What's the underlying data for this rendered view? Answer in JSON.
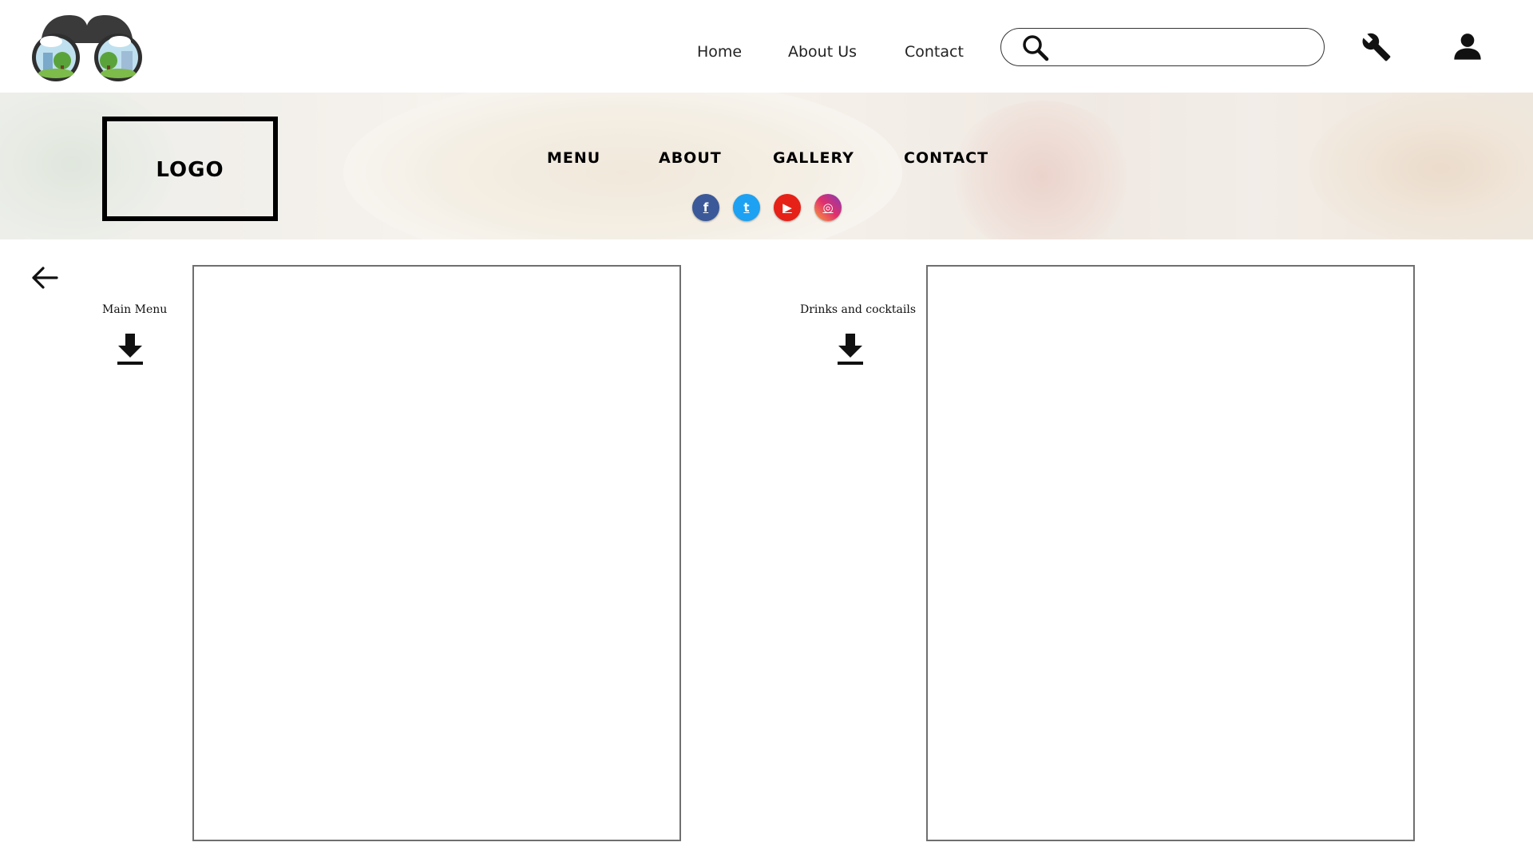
{
  "top_nav": {
    "home": "Home",
    "about": "About Us",
    "contact": "Contact"
  },
  "search": {
    "placeholder": "",
    "value": "",
    "icon": "search-icon"
  },
  "toolbar_icons": [
    "wrench-icon",
    "user-icon"
  ],
  "hero": {
    "logo_text": "LOGO",
    "nav": {
      "menu": "MENU",
      "about": "ABOUT",
      "gallery": "GALLERY",
      "contact": "CONTACT"
    },
    "social": {
      "facebook": "f",
      "twitter": "t",
      "youtube": "▶",
      "instagram": "◎"
    }
  },
  "menus": {
    "main": {
      "label": "Main Menu",
      "icon": "download-icon"
    },
    "drinks": {
      "label": "Drinks and cocktails",
      "icon": "download-icon"
    }
  },
  "colors": {
    "facebook": "#3b5998",
    "twitter": "#1da1f2",
    "youtube": "#e62117",
    "frame_border": "#6f6f6f"
  }
}
